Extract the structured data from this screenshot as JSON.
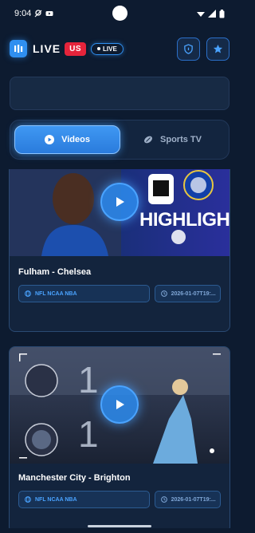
{
  "status_bar": {
    "time": "9:04"
  },
  "header": {
    "brand": "LIVE",
    "region_badge": "US",
    "live_pill": "LIVE",
    "actions": [
      "shield-icon",
      "star-icon"
    ]
  },
  "search": {
    "placeholder": ""
  },
  "tabs": [
    {
      "label": "Videos",
      "icon": "play-circle-icon",
      "active": true
    },
    {
      "label": "Sports TV",
      "icon": "ball-icon",
      "active": false
    }
  ],
  "matches": [
    {
      "title": "Fulham - Chelsea",
      "league_tags": "NFL NCAA NBA",
      "date": "2026-01-07T19:...",
      "thumbnail_caption": "HIGHLIGHTS"
    },
    {
      "title": "Manchester City - Brighton",
      "league_tags": "NFL NCAA NBA",
      "date": "2026-01-07T19:...",
      "score_home": "1",
      "score_away": "1"
    }
  ],
  "colors": {
    "background": "#0d1b30",
    "accent": "#2f8ff0",
    "badge_red": "#e5243b"
  }
}
